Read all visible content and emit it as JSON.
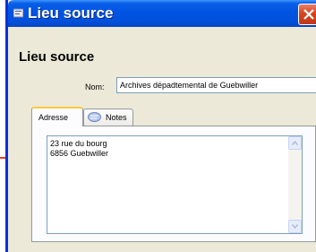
{
  "window": {
    "title": "Lieu source",
    "heading": "Lieu source",
    "nom_label": "Nom:",
    "nom_value": "Archives dépadtemental de Guebwiller"
  },
  "tabs": [
    {
      "label": "Adresse",
      "selected": true
    },
    {
      "label": "Notes",
      "selected": false,
      "icon": "notes-icon"
    }
  ],
  "address": {
    "text": "23 rue du bourg\n6856 Guebwiller"
  },
  "colors": {
    "titlebar": "#0054e3",
    "window_bg": "#ece9d8",
    "close": "#d6451f",
    "accent": "#e8402a"
  }
}
